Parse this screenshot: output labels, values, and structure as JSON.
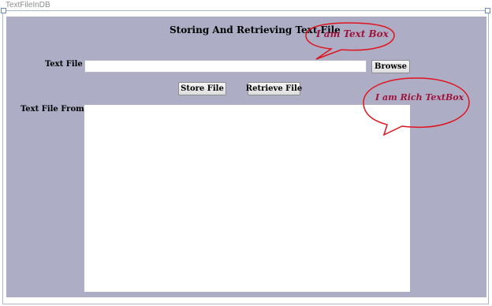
{
  "window": {
    "title": "TextFileInDB"
  },
  "form": {
    "heading": "Storing And Retrieving Text File",
    "text_file_label": "Text File",
    "text_file_value": "",
    "browse_label": "Browse",
    "store_label": "Store File",
    "retrieve_label": "Retrieve File",
    "from_db_label": "Text File From DB:",
    "rich_text_value": ""
  },
  "annotations": {
    "textbox_callout": "I am Text Box",
    "richtextbox_callout": "I am Rich TextBox"
  },
  "colors": {
    "panel_background": "#adadc6",
    "callout_stroke": "#e0141e",
    "callout_text": "#a0143a"
  }
}
